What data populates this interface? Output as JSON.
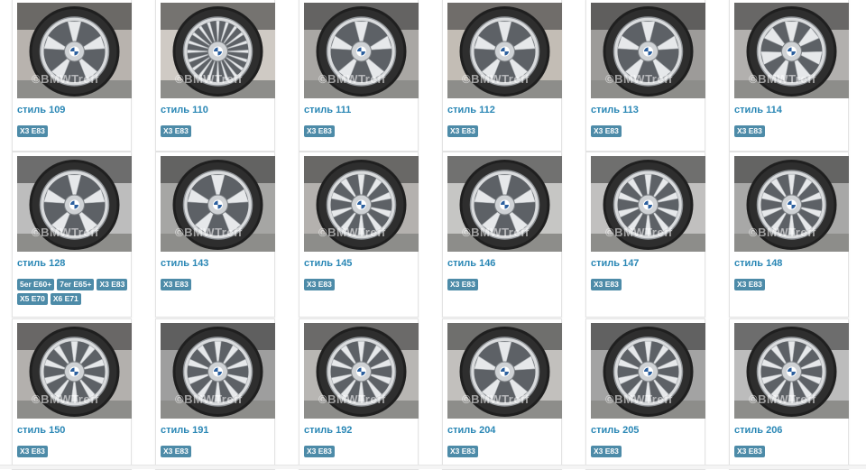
{
  "watermark": "©BMWTreff",
  "colors": {
    "title": "#2a87b5",
    "tag_bg": "#4d8ba8"
  },
  "wheels": [
    {
      "title": "стиль 109",
      "tags": [
        "X3 E83"
      ],
      "spokes": 5,
      "bg": "#b8b3ae"
    },
    {
      "title": "стиль 110",
      "tags": [
        "X3 E83"
      ],
      "spokes": 20,
      "bg": "#cfcac4"
    },
    {
      "title": "стиль 111",
      "tags": [
        "X3 E83"
      ],
      "spokes": 5,
      "bg": "#a9a7a4"
    },
    {
      "title": "стиль 112",
      "tags": [
        "X3 E83"
      ],
      "spokes": 5,
      "bg": "#c3bdb5"
    },
    {
      "title": "стиль 113",
      "tags": [
        "X3 E83"
      ],
      "spokes": 5,
      "bg": "#9d9b99"
    },
    {
      "title": "стиль 114",
      "tags": [
        "X3 E83"
      ],
      "spokes": 7,
      "bg": "#b2b0ae"
    },
    {
      "title": "стиль 128",
      "tags": [
        "5er E60+",
        "7er E65+",
        "X3 E83",
        "X5 E70",
        "X6 E71"
      ],
      "spokes": 5,
      "bg": "#bdbdbd"
    },
    {
      "title": "стиль 143",
      "tags": [
        "X3 E83"
      ],
      "spokes": 5,
      "bg": "#a6a6a4"
    },
    {
      "title": "стиль 145",
      "tags": [
        "X3 E83"
      ],
      "spokes": 10,
      "bg": "#b4b1ae"
    },
    {
      "title": "стиль 146",
      "tags": [
        "X3 E83"
      ],
      "spokes": 5,
      "bg": "#c6c6c4"
    },
    {
      "title": "стиль 147",
      "tags": [
        "X3 E83"
      ],
      "spokes": 10,
      "bg": "#c1c0bf"
    },
    {
      "title": "стиль 148",
      "tags": [
        "X3 E83"
      ],
      "spokes": 10,
      "bg": "#a8a8a7"
    },
    {
      "title": "стиль 150",
      "tags": [
        "X3 E83"
      ],
      "spokes": 10,
      "bg": "#b3b0ad"
    },
    {
      "title": "стиль 191",
      "tags": [
        "X3 E83"
      ],
      "spokes": 10,
      "bg": "#9e9e9e"
    },
    {
      "title": "стиль 192",
      "tags": [
        "X3 E83"
      ],
      "spokes": 10,
      "bg": "#b8b6b3"
    },
    {
      "title": "стиль 204",
      "tags": [
        "X3 E83"
      ],
      "spokes": 5,
      "bg": "#c2c0bd"
    },
    {
      "title": "стиль 205",
      "tags": [
        "X3 E83"
      ],
      "spokes": 10,
      "bg": "#a3a3a3"
    },
    {
      "title": "стиль 206",
      "tags": [
        "X3 E83"
      ],
      "spokes": 10,
      "bg": "#bcbcbc"
    }
  ]
}
